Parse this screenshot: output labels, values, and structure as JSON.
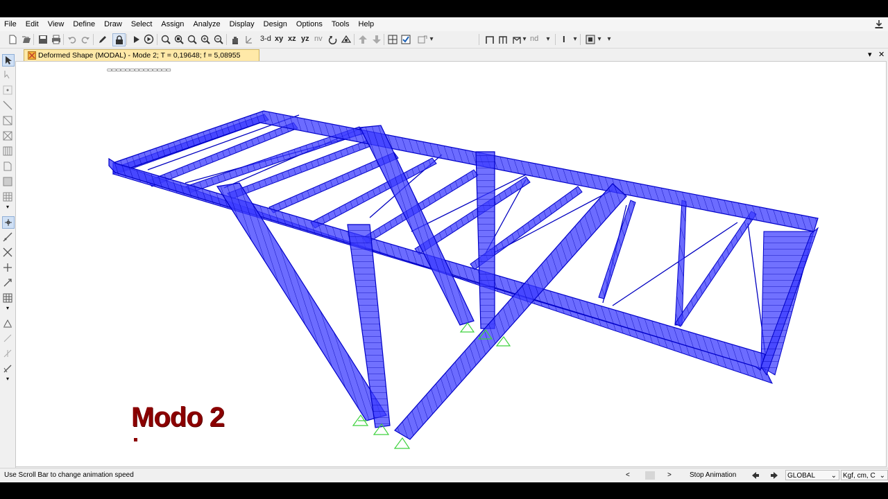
{
  "menu": [
    "File",
    "Edit",
    "View",
    "Define",
    "Draw",
    "Select",
    "Assign",
    "Analyze",
    "Display",
    "Design",
    "Options",
    "Tools",
    "Help"
  ],
  "toolbar": {
    "view_3d": "3-d",
    "view_xy": "xy",
    "view_xz": "xz",
    "view_yz": "yz",
    "view_nv": "nv",
    "nd": "nd",
    "section_label": "I"
  },
  "window": {
    "tab_title": "Deformed Shape (MODAL) - Mode 2; T = 0,19648;  f = 5,08955",
    "dropdown": "▾",
    "close": "✕"
  },
  "canvas": {
    "annotation": "Modo 2",
    "dashes": "▭▭▭▭▭▭▭▭▭▭▭▭▭▭"
  },
  "status": {
    "message": "Use Scroll Bar to change animation speed",
    "scroll_left": "<",
    "scroll_right": ">",
    "stop_animation": "Stop Animation",
    "coord_system": "GLOBAL",
    "units": "Kgf, cm, C"
  },
  "colors": {
    "frame_fill": "#3a3aff",
    "frame_stroke": "#0000c8",
    "support": "#3fd23f",
    "annotation": "#8b0000",
    "tab_bg": "#ffe9a8"
  }
}
